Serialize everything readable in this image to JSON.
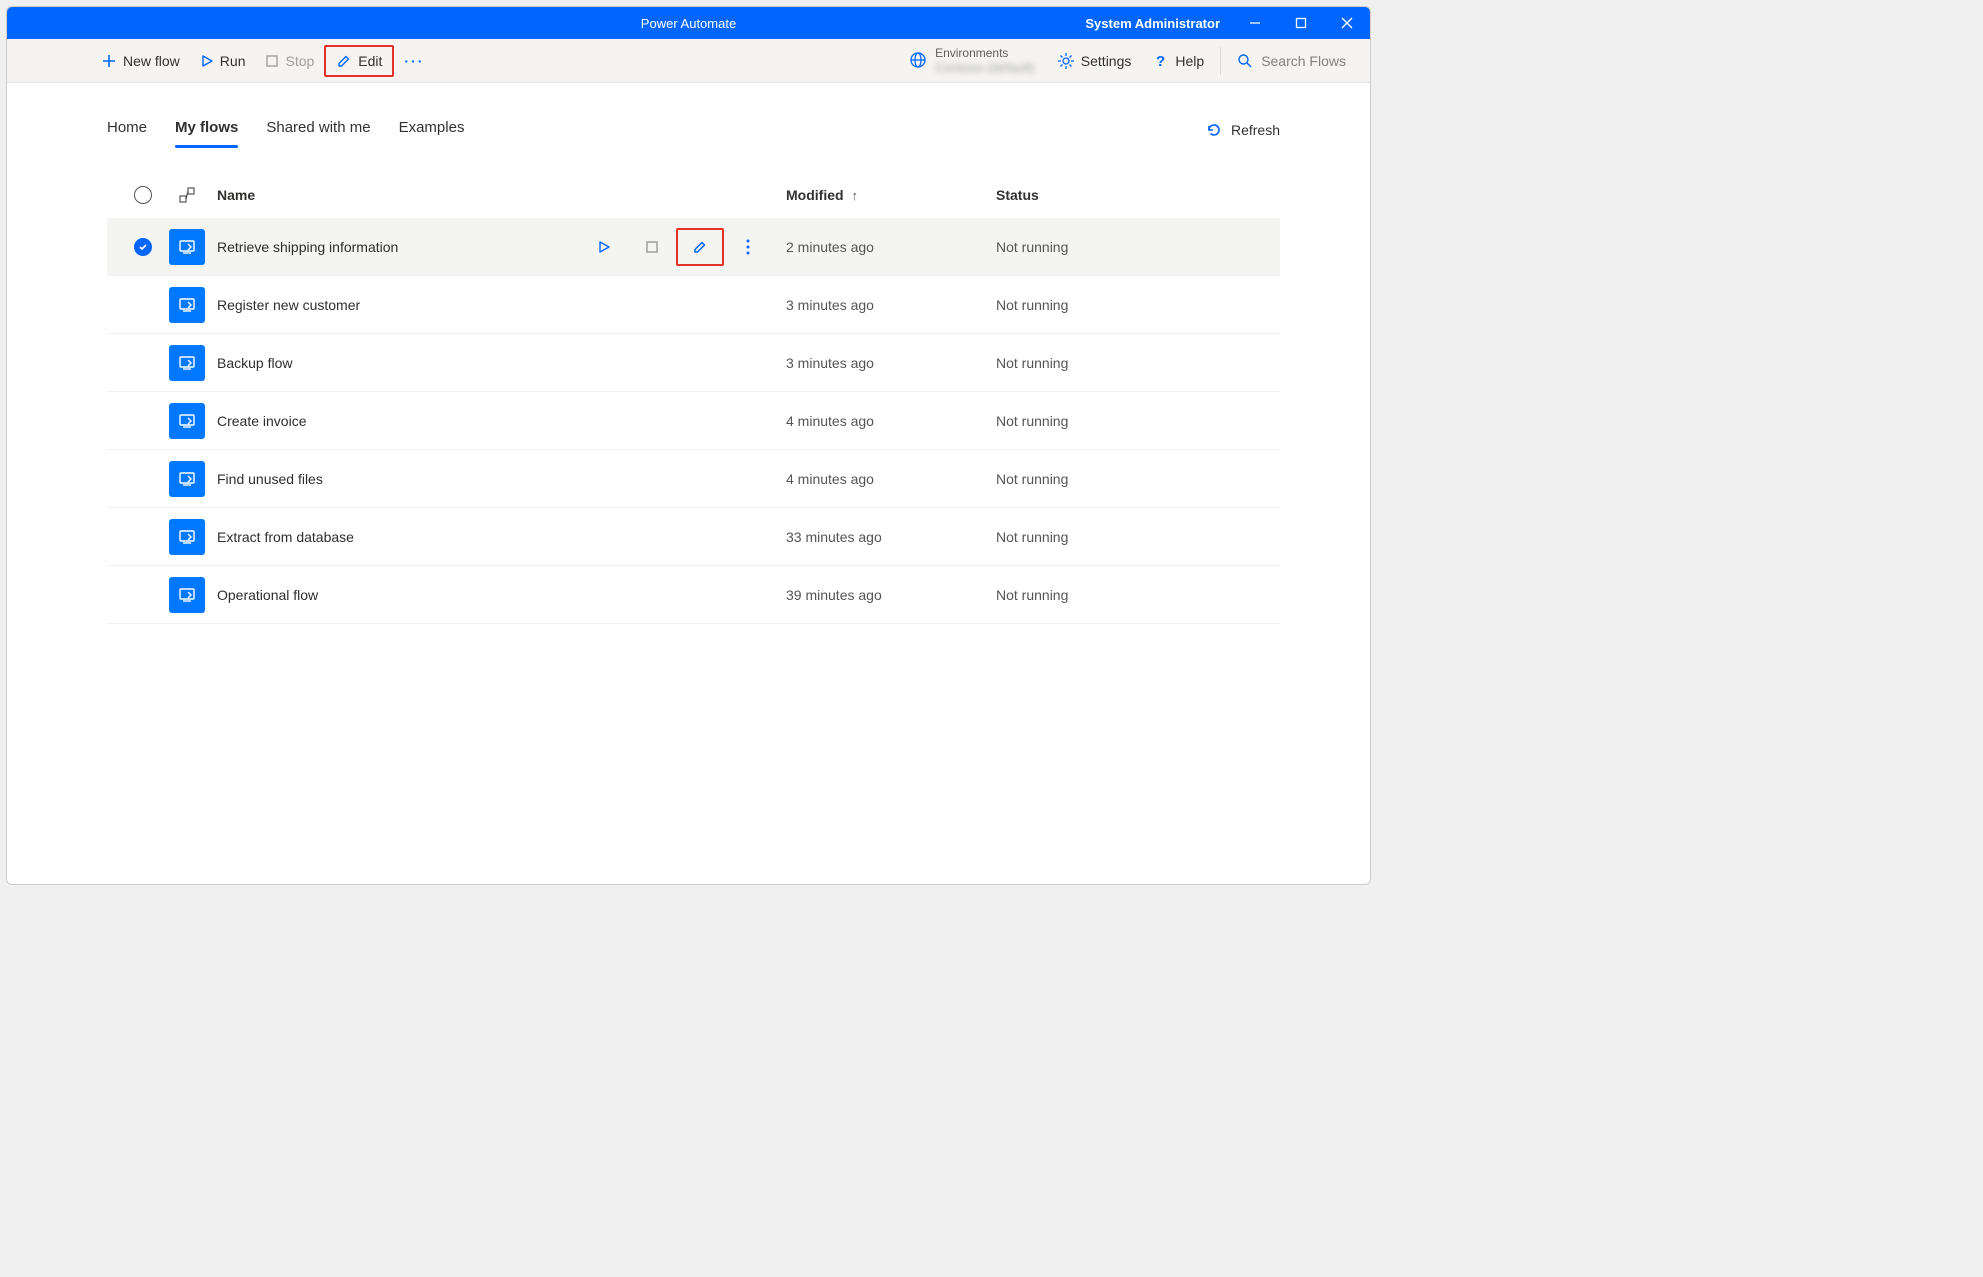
{
  "window": {
    "title": "Power Automate",
    "user": "System Administrator"
  },
  "toolbar": {
    "new_flow": "New flow",
    "run": "Run",
    "stop": "Stop",
    "edit": "Edit",
    "environments_label": "Environments",
    "environments_value": "Contoso (default)",
    "settings": "Settings",
    "help": "Help",
    "search_placeholder": "Search Flows"
  },
  "tabs": {
    "home": "Home",
    "my_flows": "My flows",
    "shared": "Shared with me",
    "examples": "Examples",
    "refresh": "Refresh"
  },
  "columns": {
    "name": "Name",
    "modified": "Modified",
    "status": "Status"
  },
  "flows": [
    {
      "name": "Retrieve shipping information",
      "modified": "2 minutes ago",
      "status": "Not running",
      "selected": true
    },
    {
      "name": "Register new customer",
      "modified": "3 minutes ago",
      "status": "Not running",
      "selected": false
    },
    {
      "name": "Backup flow",
      "modified": "3 minutes ago",
      "status": "Not running",
      "selected": false
    },
    {
      "name": "Create invoice",
      "modified": "4 minutes ago",
      "status": "Not running",
      "selected": false
    },
    {
      "name": "Find unused files",
      "modified": "4 minutes ago",
      "status": "Not running",
      "selected": false
    },
    {
      "name": "Extract from database",
      "modified": "33 minutes ago",
      "status": "Not running",
      "selected": false
    },
    {
      "name": "Operational flow",
      "modified": "39 minutes ago",
      "status": "Not running",
      "selected": false
    }
  ]
}
